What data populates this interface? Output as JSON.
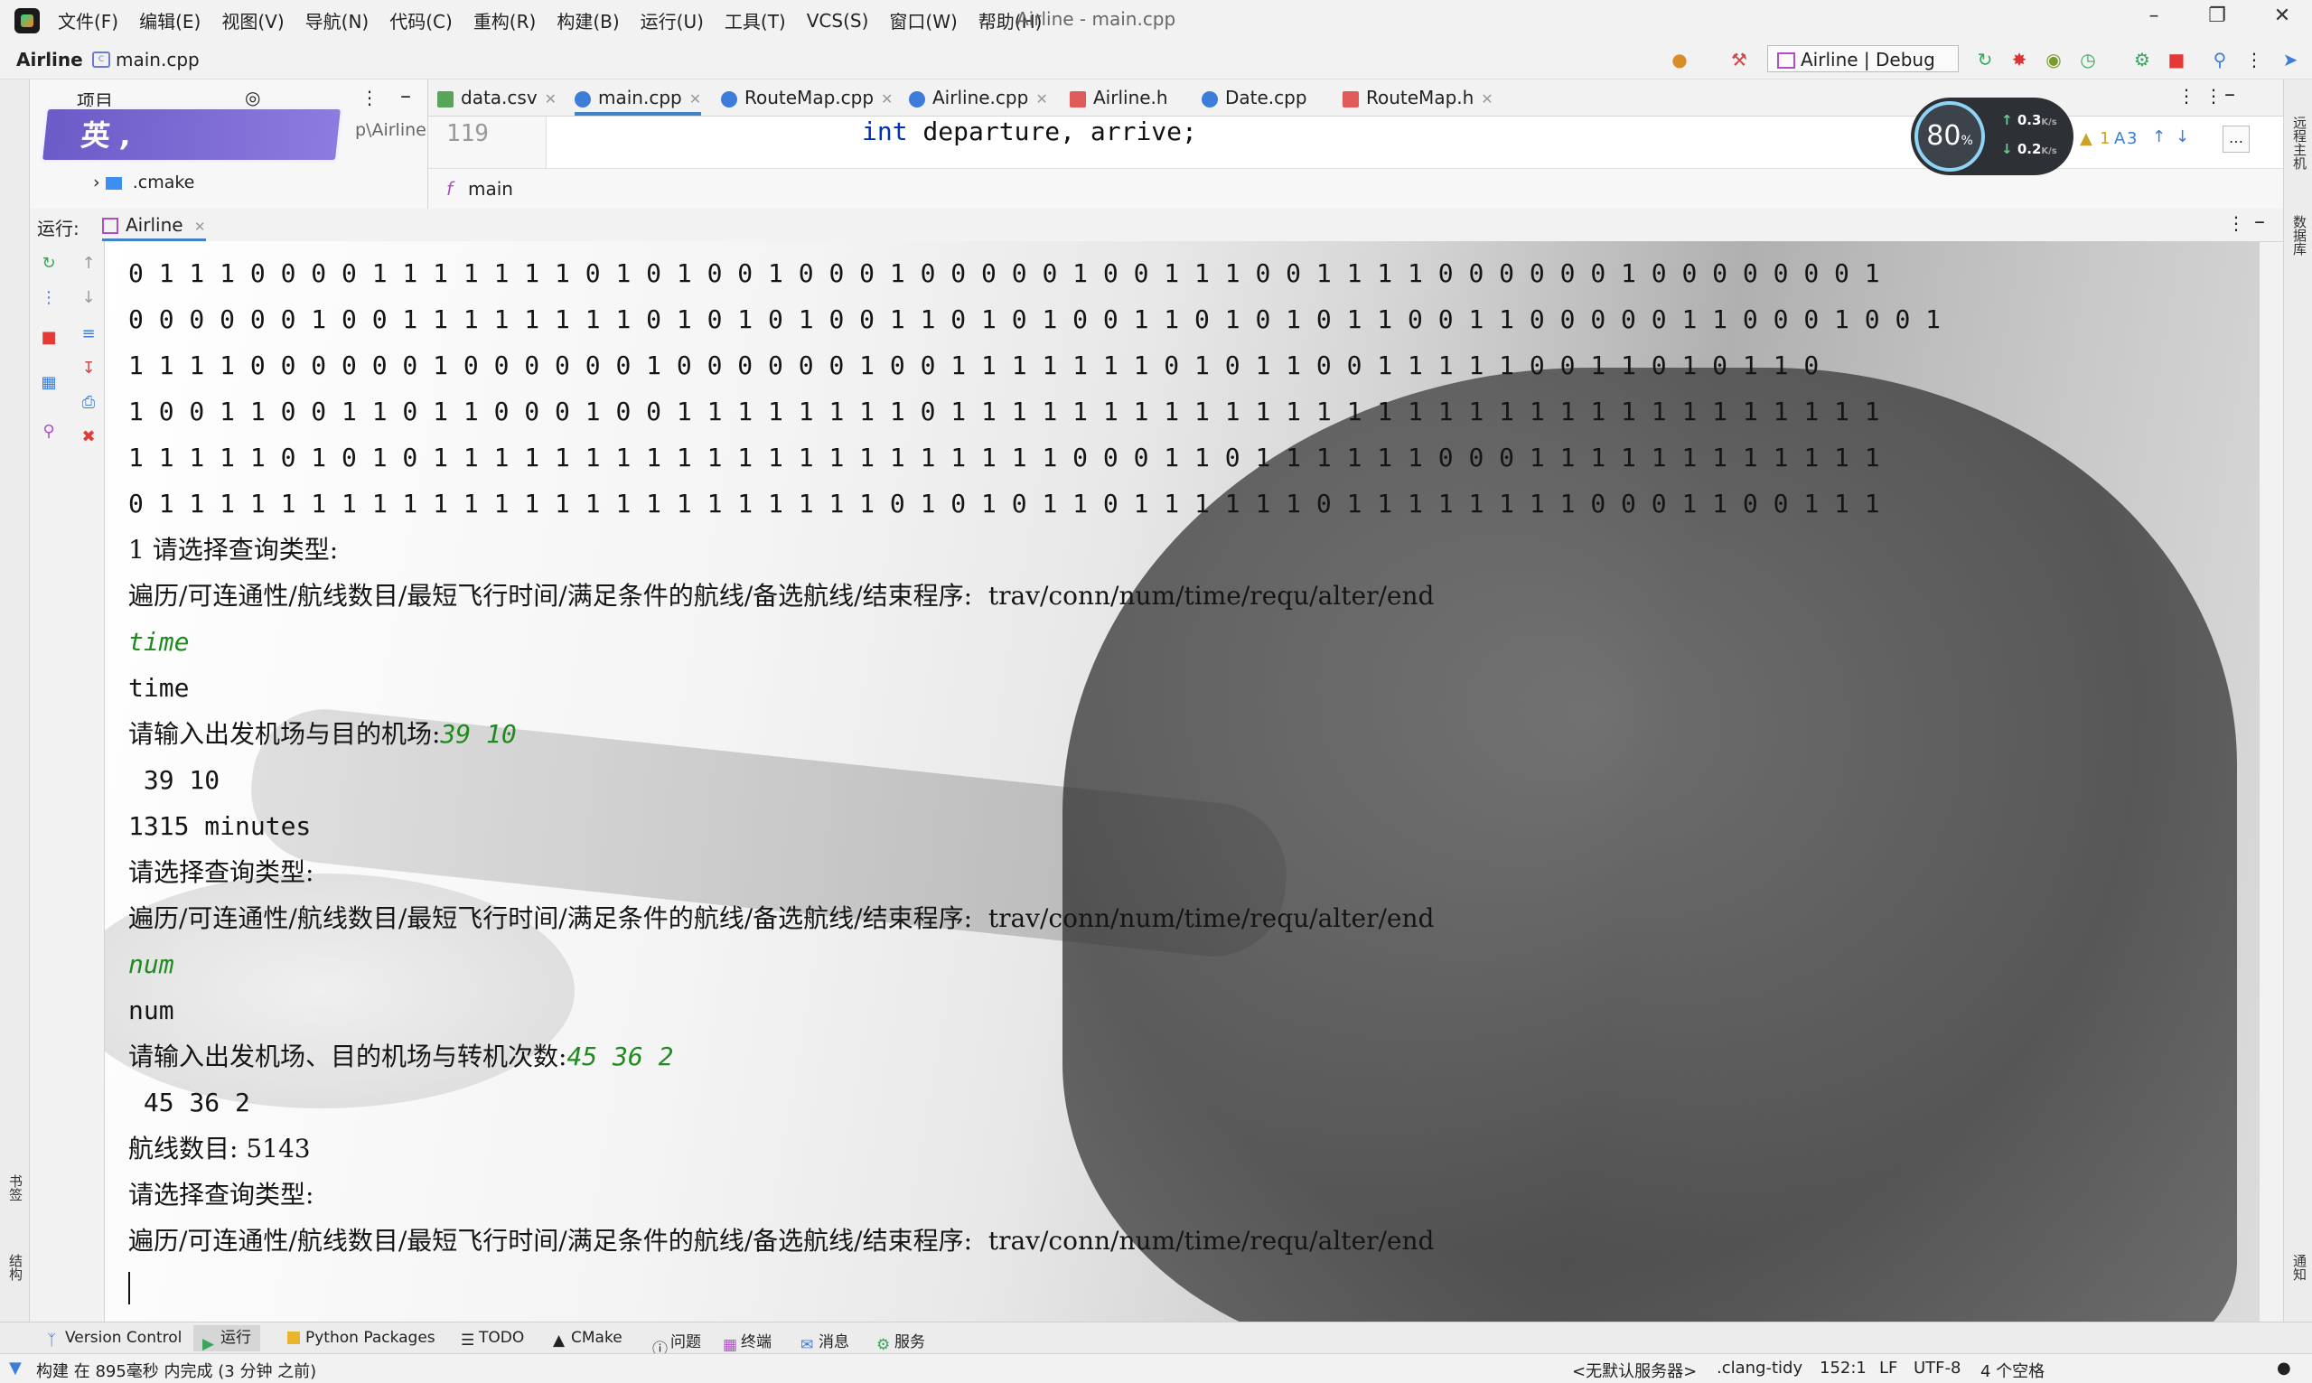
{
  "menubar": {
    "items": [
      "文件(F)",
      "编辑(E)",
      "视图(V)",
      "导航(N)",
      "代码(C)",
      "重构(R)",
      "构建(B)",
      "运行(U)",
      "工具(T)",
      "VCS(S)",
      "窗口(W)",
      "帮助(H)"
    ],
    "window_title": "Airline - main.cpp"
  },
  "navbar": {
    "project": "Airline",
    "file": "main.cpp",
    "run_config": "Airline | Debug"
  },
  "project_panel": {
    "header": "项目",
    "banner_text": "英 ,",
    "path": "p\\Airline",
    "tree_item": ".cmake"
  },
  "editor_tabs": [
    {
      "label": "data.csv",
      "color": "#5aa45a"
    },
    {
      "label": "main.cpp",
      "color": "#3c7dd9"
    },
    {
      "label": "RouteMap.cpp",
      "color": "#3c7dd9"
    },
    {
      "label": "Airline.cpp",
      "color": "#3c7dd9"
    },
    {
      "label": "Airline.h",
      "color": "#e05a5a"
    },
    {
      "label": "Date.cpp",
      "color": "#3c7dd9"
    },
    {
      "label": "RouteMap.h",
      "color": "#e05a5a"
    }
  ],
  "editor": {
    "line_number": "119",
    "code_keyword": "int",
    "code_rest": " departure, arrive;",
    "breadcrumb": "main",
    "inspections_warn": "1",
    "inspections_typo": "3"
  },
  "perf_widget": {
    "cpu": "80",
    "cpu_unit": "%",
    "up": "0.3",
    "down": "0.2",
    "rate_unit": "K/s"
  },
  "run_panel": {
    "label": "运行:",
    "tab": "Airline"
  },
  "console": {
    "matrix_rows": [
      "0 1 1 1 0 0 0 0 1 1 1 1 1 1 1 0 1 0 1 0 0 1 0 0 0 1 0 0 0 0 0 1 0 0 1 1 1 0 0 1 1 1 1 0 0 0 0 0 0 1 0 0 0 0 0 0 0 1",
      "0 0 0 0 0 0 1 0 0 1 1 1 1 1 1 1 1 0 1 0 1 0 1 0 0 1 1 0 1 0 1 0 0 1 1 0 1 0 1 0 1 1 0 0 1 1 0 0 0 0 0 1 1 0 0 0 1 0 0 1",
      "1 1 1 1 0 0 0 0 0 0 1 0 0 0 0 0 0 1 0 0 0 0 0 0 1 0 0 1 1 1 1 1 1 1 0 1 0 1 1 0 0 1 1 1 1 1 0 0 1 1 0 1 0 1 1 0",
      "1 0 0 1 1 0 0 1 1 0 1 1 0 0 0 1 0 0 1 1 1 1 1 1 1 1 0 1 1 1 1 1 1 1 1 1 1 1 1 1 1 1 1 1 1 1 1 1 1 1 1 1 1 1 1 1 1 1",
      "1 1 1 1 1 0 1 0 1 0 1 1 1 1 1 1 1 1 1 1 1 1 1 1 1 1 1 1 1 1 1 0 0 0 1 1 0 1 1 1 1 1 1 0 0 0 1 1 1 1 1 1 1 1 1 1 1 1",
      "0 1 1 1 1 1 1 1 1 1 1 1 1 1 1 1 1 1 1 1 1 1 1 1 1 0 1 0 1 0 1 1 0 1 1 1 1 1 1 0 1 1 1 1 1 1 1 1 0 0 0 1 1 0 0 1 1 1"
    ],
    "lines": [
      {
        "text": "1 请选择查询类型:",
        "input": ""
      },
      {
        "text": "遍历/可连通性/航线数目/最短飞行时间/满足条件的航线/备选航线/结束程序:  trav/conn/num/time/requ/alter/end",
        "input": ""
      },
      {
        "text": "",
        "input": "time"
      },
      {
        "text": "time",
        "input": ""
      },
      {
        "text": "请输入出发机场与目的机场:",
        "input": "39 10"
      },
      {
        "text": " 39 10",
        "input": ""
      },
      {
        "text": "1315 minutes",
        "input": ""
      },
      {
        "text": "请选择查询类型:",
        "input": ""
      },
      {
        "text": "遍历/可连通性/航线数目/最短飞行时间/满足条件的航线/备选航线/结束程序:  trav/conn/num/time/requ/alter/end",
        "input": ""
      },
      {
        "text": "",
        "input": "num"
      },
      {
        "text": "num",
        "input": ""
      },
      {
        "text": "请输入出发机场、目的机场与转机次数:",
        "input": "45 36 2"
      },
      {
        "text": " 45 36 2",
        "input": ""
      },
      {
        "text": "航线数目: 5143",
        "input": ""
      },
      {
        "text": "请选择查询类型:",
        "input": ""
      },
      {
        "text": "遍历/可连通性/航线数目/最短飞行时间/满足条件的航线/备选航线/结束程序:  trav/conn/num/time/requ/alter/end",
        "input": ""
      }
    ]
  },
  "side_labels": {
    "bookmarks": "书签",
    "structure": "结构",
    "remote_host": "远程主机",
    "database": "数据库",
    "notifications": "通知"
  },
  "bottom_tools": [
    "Version Control",
    "运行",
    "Python Packages",
    "TODO",
    "CMake",
    "问题",
    "终端",
    "消息",
    "服务"
  ],
  "statusbar": {
    "message": "构建 在 895毫秒 内完成 (3 分钟 之前)",
    "server": "<无默认服务器>",
    "linter": ".clang-tidy",
    "position": "152:1",
    "line_sep": "LF",
    "encoding": "UTF-8",
    "indent": "4 个空格"
  },
  "colors": {
    "accent": "#4083c9",
    "console_input": "#1f8b1f",
    "keyword": "#0033b3",
    "stop": "#e53935"
  }
}
